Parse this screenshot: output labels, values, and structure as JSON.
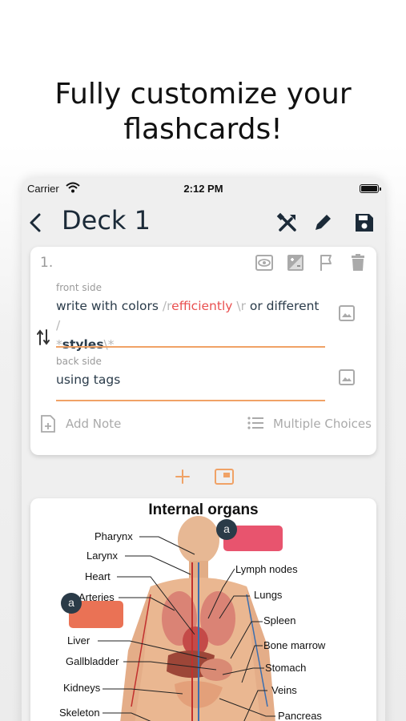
{
  "headline": {
    "line1": "Fully customize your",
    "line2": "flashcards!"
  },
  "status": {
    "carrier": "Carrier",
    "time": "2:12 PM"
  },
  "nav": {
    "title": "Deck 1"
  },
  "card": {
    "number": "1.",
    "front_label": "front side",
    "front_text": {
      "p1": "write with colors ",
      "p2": "/r",
      "p3": "efficiently",
      "p4": " \\r",
      "p5": " or different ",
      "p6": "/",
      "p7": "*",
      "p8": "styles",
      "p9": "\\*"
    },
    "back_label": "back side",
    "back_text": "using tags",
    "add_note": "Add Note",
    "multiple_choices": "Multiple Choices"
  },
  "diagram": {
    "title": "Internal organs",
    "labels": {
      "pharynx": "Pharynx",
      "larynx": "Larynx",
      "heart": "Heart",
      "arteries": "Arteries",
      "liver": "Liver",
      "gallbladder": "Gallbladder",
      "kidneys": "Kidneys",
      "skeleton": "Skeleton",
      "lymph": "Lymph nodes",
      "lungs": "Lungs",
      "spleen": "Spleen",
      "bone_marrow": "Bone marrow",
      "stomach": "Stomach",
      "veins": "Veins",
      "pancreas": "Pancreas"
    },
    "badge_letter": "a",
    "colors": {
      "mask_pink": "#e8546e",
      "mask_orange": "#ea7255",
      "accent": "#f0a266"
    }
  }
}
